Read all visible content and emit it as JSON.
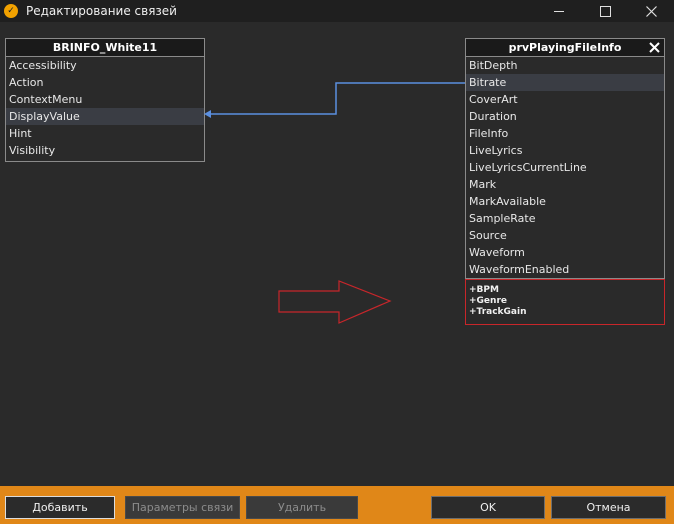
{
  "window": {
    "title": "Редактирование связей"
  },
  "left_table": {
    "title": "BRINFO_White11",
    "fields": [
      "Accessibility",
      "Action",
      "ContextMenu",
      "DisplayValue",
      "Hint",
      "Visibility"
    ],
    "selected": "DisplayValue"
  },
  "right_table": {
    "title": "prvPlayingFileInfo",
    "fields": [
      "BitDepth",
      "Bitrate",
      "CoverArt",
      "Duration",
      "FileInfo",
      "LiveLyrics",
      "LiveLyricsCurrentLine",
      "Mark",
      "MarkAvailable",
      "SampleRate",
      "Source",
      "Waveform",
      "WaveformEnabled"
    ],
    "selected": "Bitrate",
    "extra_fields": [
      "+BPM",
      "+Genre",
      "+TrackGain"
    ]
  },
  "link": {
    "from": "Bitrate",
    "to": "DisplayValue",
    "color": "#5b8fe0"
  },
  "annotation": {
    "arrow_color": "#c8262a",
    "extras_border_color": "#c8262a"
  },
  "footer": {
    "add_label": "Добавить",
    "link_params_label": "Параметры связи",
    "delete_label": "Удалить",
    "ok_label": "OK",
    "cancel_label": "Отмена",
    "background": "#e08718"
  },
  "icons": {
    "app": "app-icon",
    "minimize": "minimize-icon",
    "maximize": "maximize-icon",
    "close": "close-icon",
    "table_close": "close-icon"
  }
}
